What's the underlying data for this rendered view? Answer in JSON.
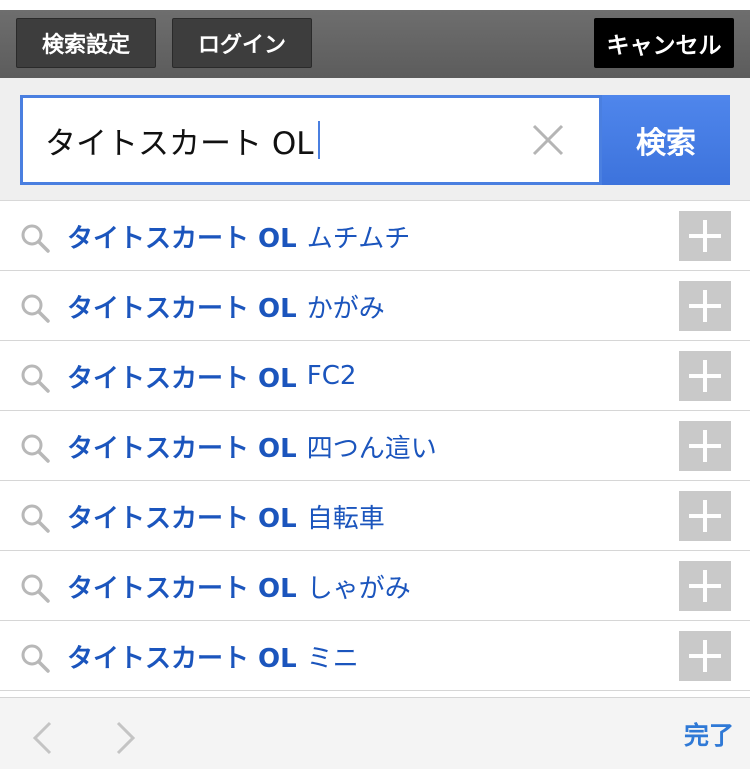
{
  "header": {
    "settings_label": "検索設定",
    "login_label": "ログイン",
    "cancel_label": "キャンセル"
  },
  "search": {
    "query": "タイトスカート OL",
    "button_label": "検索"
  },
  "suggestions": [
    {
      "query": "タイトスカート OL",
      "suffix": "ムチムチ"
    },
    {
      "query": "タイトスカート OL",
      "suffix": "かがみ"
    },
    {
      "query": "タイトスカート OL",
      "suffix": "FC2"
    },
    {
      "query": "タイトスカート OL",
      "suffix": "四つん這い"
    },
    {
      "query": "タイトスカート OL",
      "suffix": "自転車"
    },
    {
      "query": "タイトスカート OL",
      "suffix": "しゃがみ"
    },
    {
      "query": "タイトスカート OL",
      "suffix": "ミニ"
    }
  ],
  "footer": {
    "done_label": "完了"
  },
  "colors": {
    "accent": "#3d73dc",
    "suggestion_text": "#1b55bd",
    "done_text": "#2f79d6"
  }
}
